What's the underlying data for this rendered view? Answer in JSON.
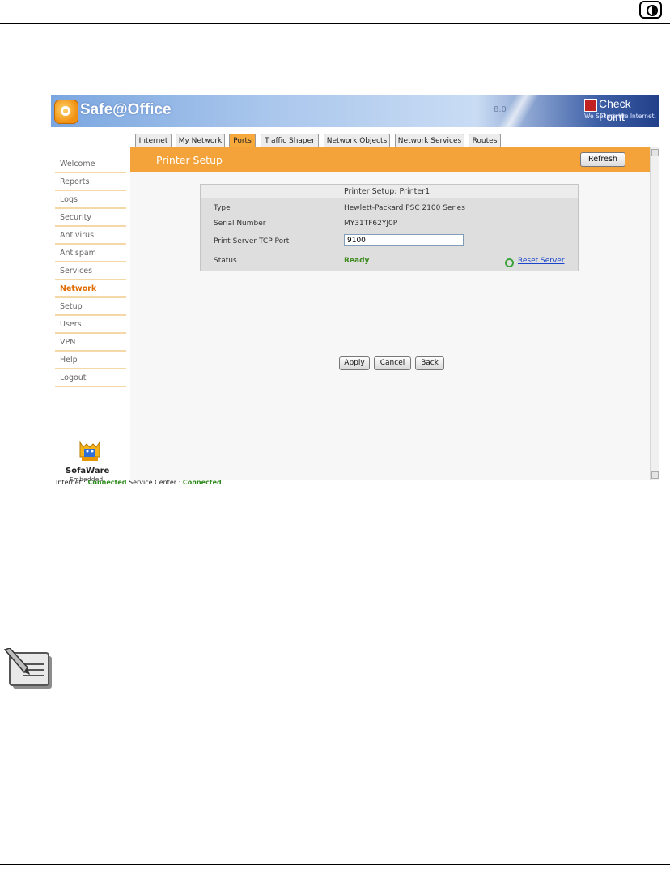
{
  "app": {
    "title": "Safe@Office",
    "version": "8.0",
    "vendor": "Check Point",
    "tagline": "We Secure the Internet."
  },
  "tabs": [
    {
      "label": "Internet"
    },
    {
      "label": "My Network"
    },
    {
      "label": "Ports",
      "active": true
    },
    {
      "label": "Traffic Shaper"
    },
    {
      "label": "Network Objects"
    },
    {
      "label": "Network Services"
    },
    {
      "label": "Routes"
    }
  ],
  "sidebar": {
    "items": [
      {
        "label": "Welcome"
      },
      {
        "label": "Reports"
      },
      {
        "label": "Logs"
      },
      {
        "label": "Security"
      },
      {
        "label": "Antivirus"
      },
      {
        "label": "Antispam"
      },
      {
        "label": "Services"
      },
      {
        "label": "Network",
        "active": true
      },
      {
        "label": "Setup"
      },
      {
        "label": "Users"
      },
      {
        "label": "VPN"
      },
      {
        "label": "Help"
      },
      {
        "label": "Logout"
      }
    ],
    "brand": {
      "name": "SofaWare",
      "sub": "Embedded"
    }
  },
  "page": {
    "title": "Printer Setup",
    "refresh_label": "Refresh"
  },
  "printer": {
    "panel_title": "Printer Setup: Printer1",
    "type_label": "Type",
    "type_value": "Hewlett-Packard PSC 2100 Series",
    "serial_label": "Serial Number",
    "serial_value": "MY31TF62YJ0P",
    "port_label": "Print Server TCP Port",
    "port_value": "9100",
    "status_label": "Status",
    "status_value": "Ready",
    "reset_label": "Reset Server"
  },
  "actions": {
    "apply": "Apply",
    "cancel": "Cancel",
    "back": "Back"
  },
  "statusbar": {
    "internet_label": "Internet :",
    "internet_value": "Connected",
    "service_label": "Service Center :",
    "service_value": "Connected"
  },
  "colors": {
    "accent_orange": "#f3a33a",
    "status_green": "#3d8a1e",
    "link_blue": "#1a44cc"
  }
}
